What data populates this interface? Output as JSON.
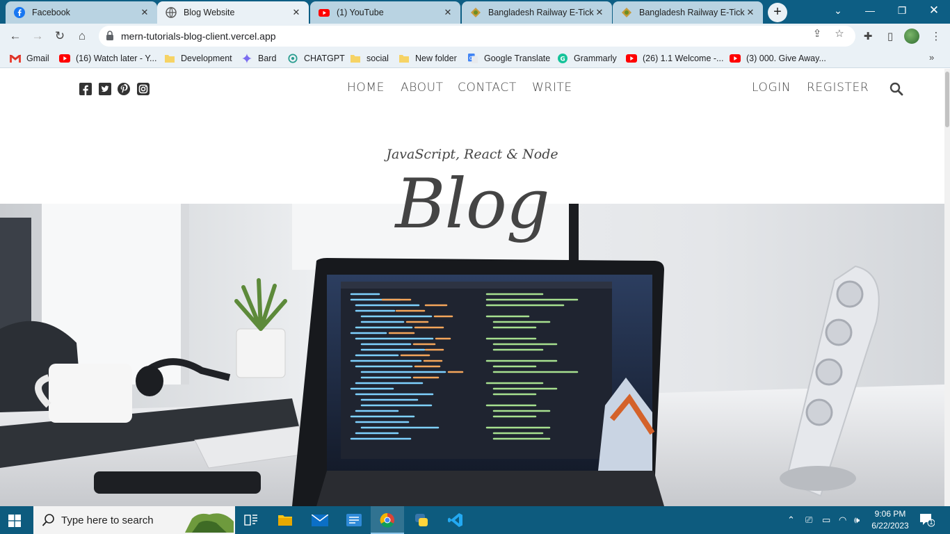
{
  "browser": {
    "tabs": [
      {
        "title": "Facebook",
        "icon": "facebook-icon",
        "active": false
      },
      {
        "title": "Blog Website",
        "icon": "globe-icon",
        "active": true
      },
      {
        "title": "(1) YouTube",
        "icon": "youtube-icon",
        "active": false
      },
      {
        "title": "Bangladesh Railway E-Ticketi",
        "icon": "railway-icon",
        "active": false
      },
      {
        "title": "Bangladesh Railway E-Ticketi",
        "icon": "railway-icon",
        "active": false
      }
    ],
    "url": "mern-tutorials-blog-client.vercel.app",
    "bookmarks": [
      {
        "label": "Gmail",
        "icon": "gmail-icon"
      },
      {
        "label": "(16) Watch later - Y...",
        "icon": "youtube-icon"
      },
      {
        "label": "Development",
        "icon": "folder-icon"
      },
      {
        "label": "Bard",
        "icon": "bard-icon"
      },
      {
        "label": "CHATGPT",
        "icon": "chatgpt-icon"
      },
      {
        "label": "social",
        "icon": "folder-icon"
      },
      {
        "label": "New folder",
        "icon": "folder-icon"
      },
      {
        "label": "Google Translate",
        "icon": "translate-icon"
      },
      {
        "label": "Grammarly",
        "icon": "grammarly-icon"
      },
      {
        "label": "(26) 1.1 Welcome -...",
        "icon": "youtube-icon"
      },
      {
        "label": "(3) 000. Give Away...",
        "icon": "youtube-icon"
      }
    ],
    "colors": {
      "frame": "#0d5e84",
      "toolbar": "#eaf1f6"
    }
  },
  "site": {
    "nav": {
      "center": [
        "HOME",
        "ABOUT",
        "CONTACT",
        "WRITE"
      ],
      "right": [
        "LOGIN",
        "REGISTER"
      ]
    },
    "social_icons": [
      "facebook-square-icon",
      "twitter-square-icon",
      "pinterest-icon",
      "instagram-icon"
    ],
    "header": {
      "subtitle": "JavaScript, React & Node",
      "title": "Blog"
    },
    "text_color": "#444444"
  },
  "taskbar": {
    "search_placeholder": "Type here to search",
    "time": "9:06 PM",
    "date": "6/22/2023",
    "notification_count": "1",
    "apps": [
      "task-view-icon",
      "file-explorer-icon",
      "mail-icon",
      "notes-icon",
      "chrome-icon",
      "python-icon",
      "vscode-icon"
    ],
    "color": "#0d5b7e"
  }
}
